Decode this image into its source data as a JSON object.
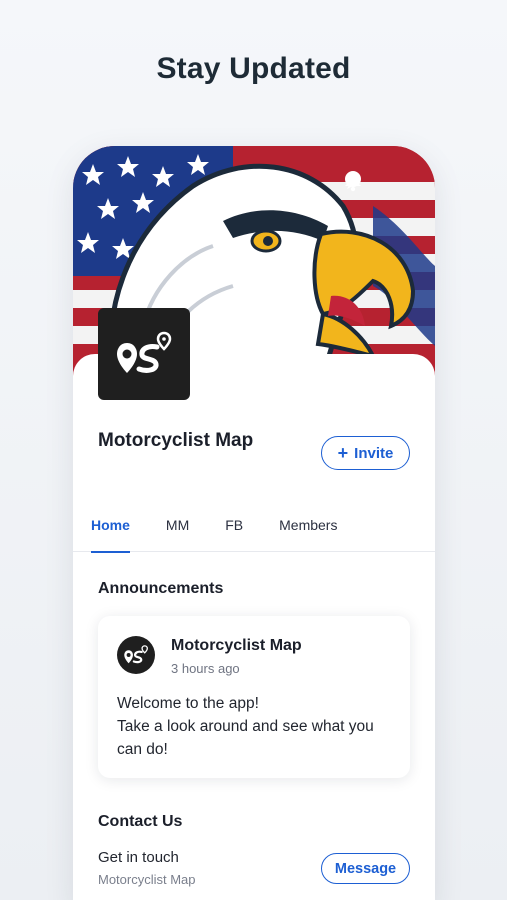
{
  "headline": "Stay Updated",
  "colors": {
    "accent": "#1d5fd3",
    "logo_bg": "#1f1f1f",
    "flag_red": "#b62230",
    "flag_blue": "#1d3a8a",
    "beak_yellow": "#f2b51c"
  },
  "icons": {
    "chat": "chat-bubble-icon",
    "bell": "notification-bell-icon",
    "logo": "map-pin-route-logo"
  },
  "group": {
    "name": "Motorcyclist Map",
    "invite_label": "Invite"
  },
  "tabs": [
    {
      "label": "Home",
      "active": true
    },
    {
      "label": "MM",
      "active": false
    },
    {
      "label": "FB",
      "active": false
    },
    {
      "label": "Members",
      "active": false
    }
  ],
  "announcements": {
    "title": "Announcements",
    "post": {
      "author": "Motorcyclist Map",
      "time": "3 hours ago",
      "line1": "Welcome to the app!",
      "line2": "Take a look around and see what you can do!"
    }
  },
  "contact": {
    "title": "Contact Us",
    "main": "Get in touch",
    "sub": "Motorcyclist Map",
    "button_label": "Message"
  }
}
